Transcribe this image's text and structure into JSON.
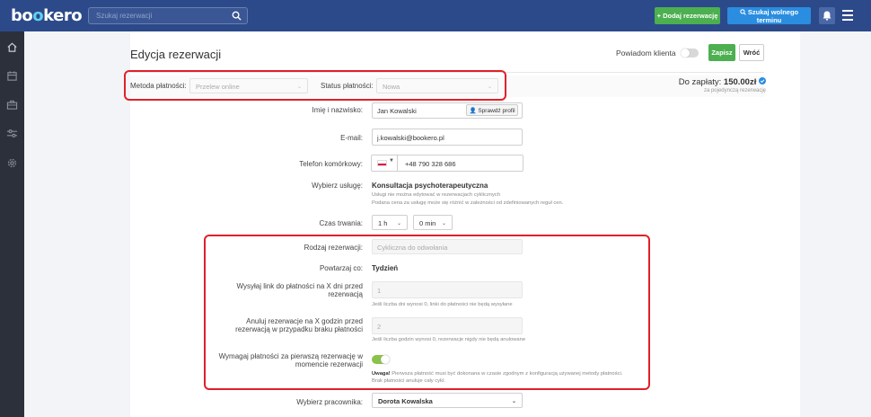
{
  "topbar": {
    "logo_main": "bo",
    "logo_o": "o",
    "logo_rest": "kero",
    "search_placeholder": "Szukaj rezerwacji",
    "add_button": "+ Dodaj rezerwację",
    "find_button": "Szukaj wolnego terminu"
  },
  "header": {
    "title": "Edycja rezerwacji",
    "notify_label": "Powiadom klienta",
    "save_label": "Zapisz",
    "back_label": "Wróć"
  },
  "payment": {
    "method_label": "Metoda płatności:",
    "method_value": "Przelew online",
    "status_label": "Status płatności:",
    "status_value": "Nowa",
    "total_label": "Do zapłaty:",
    "total_value": "150.00zł",
    "total_note": "za pojedynczą rezerwację"
  },
  "form": {
    "name_label": "Imię i nazwisko:",
    "name_value": "Jan Kowalski",
    "check_profile": "Sprawdź profil",
    "email_label": "E-mail:",
    "email_value": "j.kowalski@bookero.pl",
    "phone_label": "Telefon komórkowy:",
    "phone_value": "+48 790 328 686",
    "service_label": "Wybierz usługę:",
    "service_value": "Konsultacja psychoterapeutyczna",
    "service_hint1": "Usługi nie można edytować w rezerwacjach cyklicznych",
    "service_hint2": "Podana cena za usługę może się różnić w zależności od zdefiniowanych reguł cen.",
    "duration_label": "Czas trwania:",
    "hours_value": "1 h",
    "minutes_value": "0 min",
    "type_label": "Rodzaj rezerwacji:",
    "type_value": "Cykliczna do odwołania",
    "repeat_label": "Powtarzaj co:",
    "repeat_value": "Tydzień",
    "link_label_1": "Wysyłaj link do płatności na X dni przed",
    "link_label_2": "rezerwacją",
    "link_value": "1",
    "link_hint": "Jeśli liczba dni wynosi 0, linki do płatności nie będą wysyłane",
    "cancel_label_1": "Anuluj rezerwacje na X godzin przed",
    "cancel_label_2": "rezerwacją w przypadku braku płatności",
    "cancel_value": "2",
    "cancel_hint": "Jeśli liczba godzin wynosi 0, rezerwacje nigdy nie będą anulowane",
    "require_label_1": "Wymagaj płatności za pierwszą rezerwację w",
    "require_label_2": "momencie rezerwacji",
    "require_hint_bold": "Uwaga!",
    "require_hint_1": " Pierwsza płatność musi być dokonana w czasie zgodnym z konfiguracją używanej metody płatności.",
    "require_hint_2": "Brak płatności anuluje cały cykl.",
    "employee_label": "Wybierz pracownika:",
    "employee_value": "Dorota Kowalska"
  },
  "colors": {
    "topbar": "#2c4a8a",
    "sidebar": "#2b303b",
    "green": "#4caf50",
    "blue": "#2a8de0",
    "highlight": "#e0202a"
  }
}
